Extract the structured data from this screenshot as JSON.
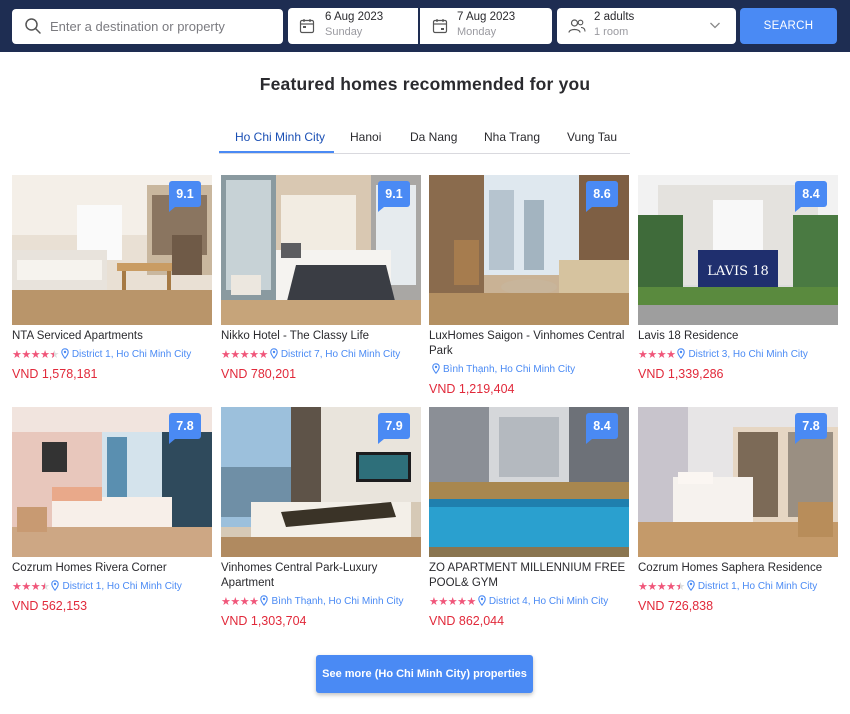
{
  "search": {
    "destination_placeholder": "Enter a destination or property",
    "checkin_date": "6 Aug 2023",
    "checkin_day": "Sunday",
    "checkout_date": "7 Aug 2023",
    "checkout_day": "Monday",
    "guests": "2 adults",
    "rooms": "1 room",
    "button": "SEARCH"
  },
  "heading": "Featured homes recommended for you",
  "tabs": [
    "Ho Chi Minh City",
    "Hanoi",
    "Da Nang",
    "Nha Trang",
    "Vung Tau"
  ],
  "active_tab": "Ho Chi Minh City",
  "colors": {
    "navy": "#1e2d52",
    "accent": "#4a8af4",
    "price": "#e1293a",
    "stars": "#f0567a"
  },
  "listings": [
    {
      "name": "NTA Serviced Apartments",
      "score": "9.1",
      "stars": 4.5,
      "location": "District 1, Ho Chi Minh City",
      "price": "VND 1,578,181"
    },
    {
      "name": "Nikko Hotel - The Classy Life",
      "score": "9.1",
      "stars": 5,
      "location": "District 7, Ho Chi Minh City",
      "price": "VND 780,201"
    },
    {
      "name": "LuxHomes Saigon - Vinhomes Central Park",
      "score": "8.6",
      "stars": 0,
      "location": "Bình Thạnh, Ho Chi Minh City",
      "price": "VND 1,219,404"
    },
    {
      "name": "Lavis 18 Residence",
      "score": "8.4",
      "stars": 4,
      "location": "District 3, Ho Chi Minh City",
      "price": "VND 1,339,286",
      "image_sign": "LAVIS 18"
    },
    {
      "name": "Cozrum Homes Rivera Corner",
      "score": "7.8",
      "stars": 3.5,
      "location": "District 1, Ho Chi Minh City",
      "price": "VND 562,153"
    },
    {
      "name": "Vinhomes Central Park-Luxury Apartment",
      "score": "7.9",
      "stars": 4,
      "location": "Bình Thạnh, Ho Chi Minh City",
      "price": "VND 1,303,704"
    },
    {
      "name": "ZO APARTMENT MILLENNIUM FREE POOL& GYM",
      "score": "8.4",
      "stars": 5,
      "location": "District 4, Ho Chi Minh City",
      "price": "VND 862,044"
    },
    {
      "name": "Cozrum Homes Saphera Residence",
      "score": "7.8",
      "stars": 4.5,
      "location": "District 1, Ho Chi Minh City",
      "price": "VND 726,838"
    }
  ],
  "see_more": "See more (Ho Chi Minh City) properties"
}
